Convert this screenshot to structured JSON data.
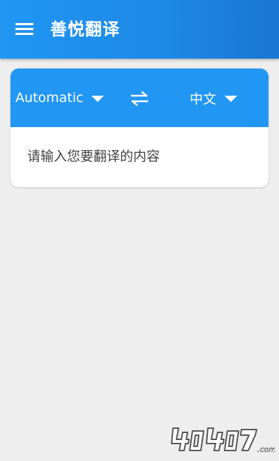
{
  "app_bar": {
    "title": "善悦翻译",
    "background": "#1e88e5"
  },
  "icons": {
    "menu": "menu-icon",
    "swap": "swap-arrows-icon",
    "source_dropdown": "chevron-down-icon",
    "target_dropdown": "chevron-down-icon"
  },
  "translator": {
    "source_language": "Automatic",
    "target_language": "中文",
    "input_placeholder": "请输入您要翻译的内容",
    "input_value": "",
    "accent": "#2196f3"
  },
  "watermark": {
    "text": "4O4O7",
    "suffix": ".com"
  }
}
